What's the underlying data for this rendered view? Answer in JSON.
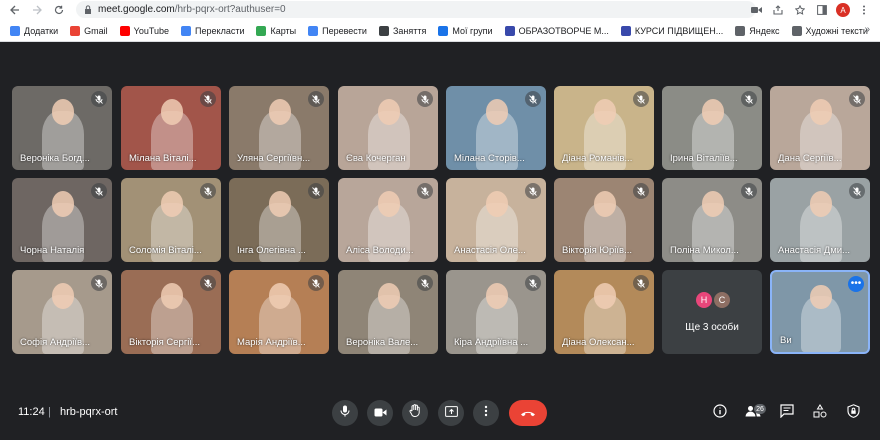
{
  "browser": {
    "url_host": "meet.google.com",
    "url_path": "/hrb-pqrx-ort?authuser=0",
    "profile_initial": "A"
  },
  "bookmarks": [
    {
      "label": "Додатки",
      "color": "#4285f4"
    },
    {
      "label": "Gmail",
      "color": "#ea4335"
    },
    {
      "label": "YouTube",
      "color": "#ff0000"
    },
    {
      "label": "Перекласти",
      "color": "#4285f4"
    },
    {
      "label": "Карты",
      "color": "#34a853"
    },
    {
      "label": "Перевести",
      "color": "#4285f4"
    },
    {
      "label": "Заняття",
      "color": "#3c4043"
    },
    {
      "label": "Мої групи",
      "color": "#1a73e8"
    },
    {
      "label": "ОБРАЗОТВОРЧЕ М...",
      "color": "#3949ab"
    },
    {
      "label": "КУРСИ ПІДВИЩЕН...",
      "color": "#3949ab"
    },
    {
      "label": "Яндекс",
      "color": "#5f6368"
    },
    {
      "label": "Художні тексти",
      "color": "#5f6368"
    }
  ],
  "tiles": [
    {
      "name": "Вероніка Богд...",
      "bg": "#6d6a66"
    },
    {
      "name": "Мілана Віталі...",
      "bg": "#a2554a"
    },
    {
      "name": "Уляна Сергіївн...",
      "bg": "#8a7a6a"
    },
    {
      "name": "Єва Кочерган",
      "bg": "#b8a598"
    },
    {
      "name": "Мілана Сторів...",
      "bg": "#6f8fa8"
    },
    {
      "name": "Діана Романів...",
      "bg": "#c9b48a"
    },
    {
      "name": "Ірина Віталіїв...",
      "bg": "#8b8c86"
    },
    {
      "name": "Дана Сергіїв...",
      "bg": "#b9a79a"
    },
    {
      "name": "Чорна Наталія",
      "bg": "#6e6662"
    },
    {
      "name": "Соломія Віталі...",
      "bg": "#a29176"
    },
    {
      "name": "Інга Олегівна ...",
      "bg": "#7b6c58"
    },
    {
      "name": "Аліса Володи...",
      "bg": "#b8a69a"
    },
    {
      "name": "Анастасія Оле...",
      "bg": "#c7b29c"
    },
    {
      "name": "Вікторія Юріїв...",
      "bg": "#9c8573"
    },
    {
      "name": "Поліна Микол...",
      "bg": "#8d8c87"
    },
    {
      "name": "Анастасія Дми...",
      "bg": "#9aa2a4"
    },
    {
      "name": "Софія Андріїв...",
      "bg": "#a69a8c"
    },
    {
      "name": "Вікторія Сергії...",
      "bg": "#9a6d55"
    },
    {
      "name": "Марія Андріїв...",
      "bg": "#b57f55"
    },
    {
      "name": "Вероніка Вале...",
      "bg": "#8f8577"
    },
    {
      "name": "Кіра Андріївна ...",
      "bg": "#9a958d"
    },
    {
      "name": "Діана Олексан...",
      "bg": "#b38a5a"
    }
  ],
  "more_tile": {
    "label": "Ще 3 особи",
    "bubbles": [
      {
        "letter": "Н",
        "color": "#e8467a"
      },
      {
        "letter": "С",
        "color": "#8d6e63"
      }
    ]
  },
  "self_tile": {
    "name": "Ви",
    "bg": "#7f97a8"
  },
  "bottom": {
    "time": "11:24",
    "separator": "|",
    "meeting_code": "hrb-pqrx-ort",
    "participants_count": "26"
  }
}
